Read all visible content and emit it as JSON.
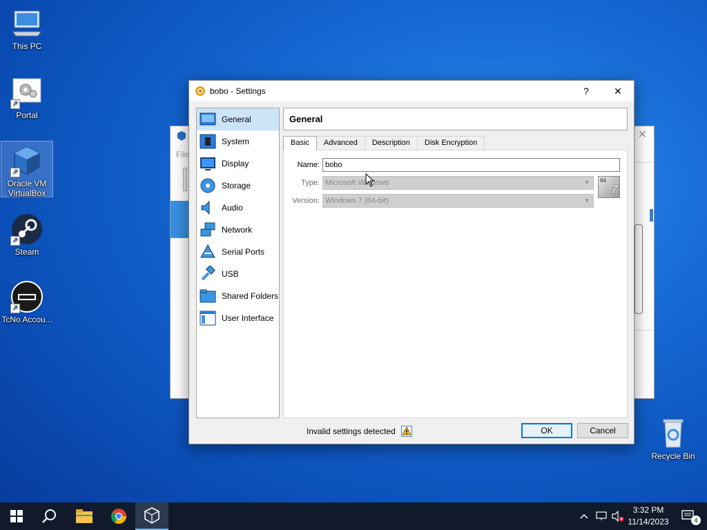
{
  "desktop": {
    "icons": [
      {
        "label": "This PC"
      },
      {
        "label": "Portal"
      },
      {
        "label": "Oracle VM VirtualBox"
      },
      {
        "label": "Steam"
      },
      {
        "label": "TcNo Accou..."
      },
      {
        "label": "Recycle Bin"
      }
    ]
  },
  "background_window": {
    "partial_text": "File"
  },
  "dialog": {
    "title": "bobo - Settings",
    "help_label": "?",
    "close_label": "✕",
    "sidebar": {
      "items": [
        {
          "label": "General",
          "icon": "general-icon"
        },
        {
          "label": "System",
          "icon": "system-icon"
        },
        {
          "label": "Display",
          "icon": "display-icon"
        },
        {
          "label": "Storage",
          "icon": "storage-icon"
        },
        {
          "label": "Audio",
          "icon": "audio-icon"
        },
        {
          "label": "Network",
          "icon": "network-icon"
        },
        {
          "label": "Serial Ports",
          "icon": "serial-ports-icon"
        },
        {
          "label": "USB",
          "icon": "usb-icon"
        },
        {
          "label": "Shared Folders",
          "icon": "shared-folders-icon"
        },
        {
          "label": "User Interface",
          "icon": "user-interface-icon"
        }
      ],
      "selected": "General"
    },
    "section_title": "General",
    "tabs": [
      {
        "label": "Basic"
      },
      {
        "label": "Advanced"
      },
      {
        "label": "Description"
      },
      {
        "label": "Disk Encryption"
      }
    ],
    "active_tab": "Basic",
    "form": {
      "name_label": "Name:",
      "name_value": "bobo",
      "type_label": "Type:",
      "type_value": "Microsoft Windows",
      "version_label": "Version:",
      "version_value": "Windows 7 (64-bit)",
      "os_badge_top": "64",
      "os_badge_main": "7"
    },
    "status_text": "Invalid settings detected",
    "ok_label": "OK",
    "cancel_label": "Cancel"
  },
  "taskbar": {
    "time": "3:32 PM",
    "date": "11/14/2023",
    "notification_count": "4"
  },
  "colors": {
    "accent": "#0078d7",
    "selection": "#cce4f7",
    "taskbar": "#101a2a"
  }
}
